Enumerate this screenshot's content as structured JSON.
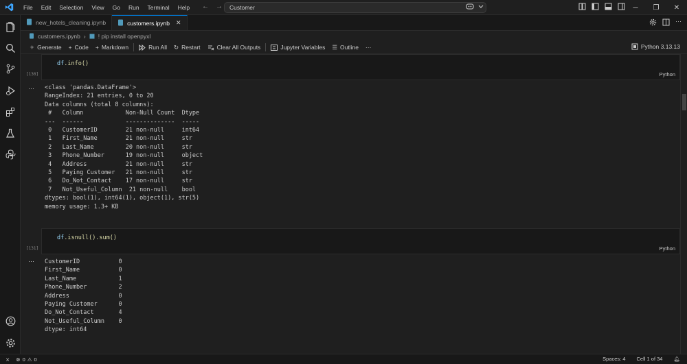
{
  "window": {
    "menu": [
      "File",
      "Edit",
      "Selection",
      "View",
      "Go",
      "Run",
      "Terminal",
      "Help"
    ],
    "search": "Customer"
  },
  "tabs": [
    {
      "label": "new_hotels_cleaning.ipynb",
      "active": false
    },
    {
      "label": "customers.ipynb",
      "active": true
    }
  ],
  "breadcrumb": {
    "file": "customers.ipynb",
    "cell": "! pip install openpyxl"
  },
  "toolbar": {
    "generate": "Generate",
    "code": "Code",
    "markdown": "Markdown",
    "run_all": "Run All",
    "restart": "Restart",
    "clear": "Clear All Outputs",
    "variables": "Jupyter Variables",
    "outline": "Outline",
    "more": "···",
    "kernel": "Python 3.13.13"
  },
  "cells": [
    {
      "exec": "[130]",
      "code_var": "df",
      "code_rest": ".info()",
      "lang": "Python",
      "output": "<class 'pandas.DataFrame'>\nRangeIndex: 21 entries, 0 to 20\nData columns (total 8 columns):\n #   Column            Non-Null Count  Dtype \n---  ------            --------------  ----- \n 0   CustomerID        21 non-null     int64 \n 1   First_Name        21 non-null     str   \n 2   Last_Name         20 non-null     str   \n 3   Phone_Number      19 non-null     object\n 4   Address           21 non-null     str   \n 5   Paying Customer   21 non-null     str   \n 6   Do_Not_Contact    17 non-null     str   \n 7   Not_Useful_Column  21 non-null    bool  \ndtypes: bool(1), int64(1), object(1), str(5)\nmemory usage: 1.3+ KB"
    },
    {
      "exec": "[131]",
      "code_var": "df",
      "code_rest": ".isnull().sum()",
      "lang": "Python",
      "output": "CustomerID           0\nFirst_Name           0\nLast_Name            1\nPhone_Number         2\nAddress              0\nPaying Customer      0\nDo_Not_Contact       4\nNot_Useful_Column    0\ndtype: int64"
    }
  ],
  "output_marker": "···",
  "status": {
    "errors": "0",
    "warnings": "0",
    "spaces": "Spaces: 4",
    "cell": "Cell 1 of 34"
  },
  "colors": {
    "accent": "#0078d4",
    "background": "#1f1f1f",
    "sidebar": "#181818"
  }
}
